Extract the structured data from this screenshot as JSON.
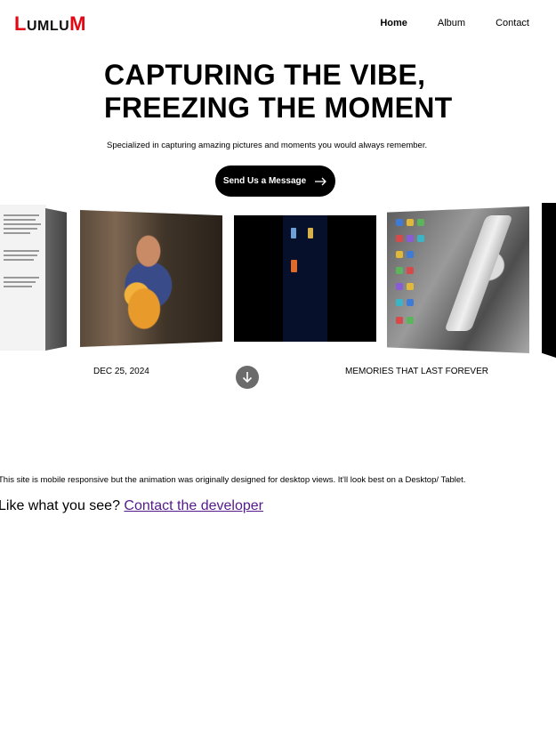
{
  "header": {
    "logo": {
      "L1": "L",
      "mid": "UMLU",
      "M": "M"
    },
    "nav": [
      {
        "label": "Home",
        "active": true
      },
      {
        "label": "Album",
        "active": false
      },
      {
        "label": "Contact",
        "active": false
      }
    ]
  },
  "hero": {
    "title_line1": "CAPTURING THE VIBE,",
    "title_line2": "FREEZING THE MOMENT",
    "subtitle": "Specialized in capturing amazing pictures and moments you would always remember.",
    "cta_label": "Send Us a Message",
    "cta_icon": "arrow-right-icon"
  },
  "carousel": {
    "cards": [
      {
        "kind": "document-screenshot"
      },
      {
        "kind": "photo"
      },
      {
        "kind": "phone-screen"
      },
      {
        "kind": "desktop-screen"
      }
    ]
  },
  "meta": {
    "date": "DEC 25, 2024",
    "tagline": "MEMORIES THAT LAST FOREVER",
    "scroll_icon": "arrow-down-icon"
  },
  "footer": {
    "note": "This site is mobile responsive but the animation was originally designed for desktop views. It'll look best on a Desktop/ Tablet.",
    "like_text": "Like what you see? ",
    "contact_link": "Contact the developer"
  },
  "colors": {
    "brand_red": "#e30613",
    "cta_bg": "#000000",
    "scroll_btn": "#6b6b6b",
    "link": "#551a8b"
  }
}
